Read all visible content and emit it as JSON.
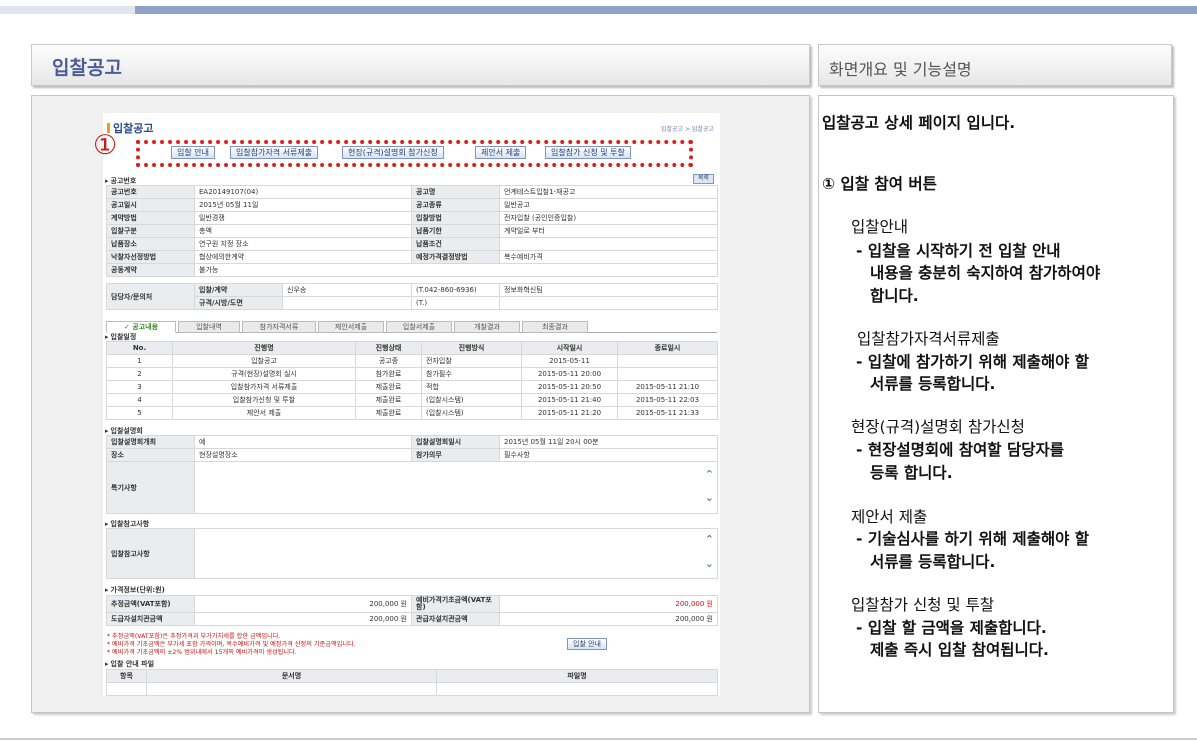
{
  "left_header": "입찰공고",
  "right_header": "화면개요 및 기능설명",
  "screen": {
    "title": "입찰공고",
    "breadcrumb": "입찰공고 > 입찰공고",
    "marker": "①",
    "buttons": [
      "입찰 안내",
      "입찰참가자격 서류제출",
      "현장(규격)설명회 참가신청",
      "제안서 제출",
      "입찰참가 신청 및 투찰"
    ],
    "sec_notice": "공고번호",
    "list_btn": "목록",
    "info": {
      "r1": [
        "공고번호",
        "EA20149107(04)",
        "공고명",
        "언계테스트입찰1-재공고"
      ],
      "r2": [
        "공고일시",
        "2015년 05월 11일",
        "공고종류",
        "일반공고"
      ],
      "r3": [
        "계약방법",
        "일반경쟁",
        "입찰방법",
        "전자입찰 (공인인증입찰)"
      ],
      "r4": [
        "입찰구분",
        "총액",
        "납품기한",
        "계약일로 부터"
      ],
      "r5": [
        "납품장소",
        "연구원 지정 장소",
        "납품조건",
        ""
      ],
      "r6": [
        "낙찰자선정방법",
        "협상에의한계약",
        "예정가격결정방법",
        "복수예비가격"
      ],
      "r7": [
        "공동계약",
        "불가능"
      ],
      "r8": [
        "담당자/문의처",
        "입찰/계약",
        "신우송",
        "(T.042-860-6936)",
        "정보화혁신팀"
      ],
      "r9": [
        "규격/시방/도면",
        "(T.)"
      ]
    },
    "tabs": [
      "공고내용",
      "입찰내역",
      "참가자격서류",
      "제안서제출",
      "입찰서제출",
      "개찰결과",
      "최종결과"
    ],
    "sec_schedule": "입찰일정",
    "sched_headers": [
      "No.",
      "진행명",
      "진행상태",
      "진행방식",
      "시작일시",
      "종료일시"
    ],
    "sched_rows": [
      [
        "1",
        "입찰공고",
        "공고중",
        "전자입찰",
        "2015-05-11",
        ""
      ],
      [
        "2",
        "규격(현장)설명회 실시",
        "참가완료",
        "참가필수",
        "2015-05-11 20:00",
        ""
      ],
      [
        "3",
        "입찰참가자격 서류제출",
        "제출완료",
        "적합",
        "2015-05-11 20:50",
        "2015-05-11 21:10"
      ],
      [
        "4",
        "입찰참가신청 및 투찰",
        "제출완료",
        "(입찰시스템)",
        "2015-05-11 21:40",
        "2015-05-11 22:03"
      ],
      [
        "5",
        "제안서 제출",
        "제출완료",
        "(입찰시스템)",
        "2015-05-11 21:20",
        "2015-05-11 21:33"
      ]
    ],
    "sec_briefing": "입찰설명회",
    "brief": {
      "r1": [
        "입찰설명회개최",
        "예",
        "입찰설명회일시",
        "2015년 05월 11일 20시 00분"
      ],
      "r2": [
        "장소",
        "현장설명장소",
        "참가의무",
        "필수사항"
      ],
      "special": "특기사항"
    },
    "sec_notice2": "입찰참고사항",
    "notice2_label": "입찰참고사항",
    "sec_price": "가격정보(단위:원)",
    "price": {
      "r1": [
        "추정금액(VAT포함)",
        "200,000 원",
        "예비가격기초금액(VAT포함)",
        "200,000 원"
      ],
      "r2": [
        "도급자설치관금액",
        "200,000 원",
        "관급자설치관금액",
        "200,000 원"
      ]
    },
    "notes": [
      "* 추정금액(VAT포함)은 추정가격과 부가가치세를 합한 금액입니다.",
      "* 예비가격 기초금액은 부가세 포함 가격이며, 복수예비가격 및 예정가격 산정의 기준금액입니다.",
      "* 예비가격 기초금액의 ±2% 범위내에서 15개의 예비가격이 생성됩니다."
    ],
    "guide_btn": "입찰 안내",
    "sec_file": "입찰 안내 파일",
    "file_headers": [
      "항목",
      "문서명",
      "파일명"
    ],
    "scroll_up": "⌃",
    "scroll_down": "⌄"
  },
  "desc": {
    "title": "입찰공고 상세 페이지 입니다.",
    "item": "① 입찰 참여 버튼",
    "b1_title": "입찰안내",
    "b1_l1": "- 입찰을 시작하기 전 입찰 안내",
    "b1_l2": "내용을 충분히 숙지하여 참가하여야",
    "b1_l3": "합니다.",
    "b2_title": "입찰참가자격서류제출",
    "b2_l1": "- 입찰에 참가하기 위해 제출해야 할",
    "b2_l2": "서류를 등록합니다.",
    "b3_title": "현장(규격)설명회 참가신청",
    "b3_l1": "- 현장설명회에 참여할 담당자를",
    "b3_l2": "등록 합니다.",
    "b4_title": "제안서 제출",
    "b4_l1": "- 기술심사를 하기 위해 제출해야 할",
    "b4_l2": "서류를 등록합니다.",
    "b5_title": "입찰참가 신청 및 투찰",
    "b5_l1": "- 입찰 할 금액을 제출합니다.",
    "b5_l2": "제출 즉시 입찰 참여됩니다."
  }
}
